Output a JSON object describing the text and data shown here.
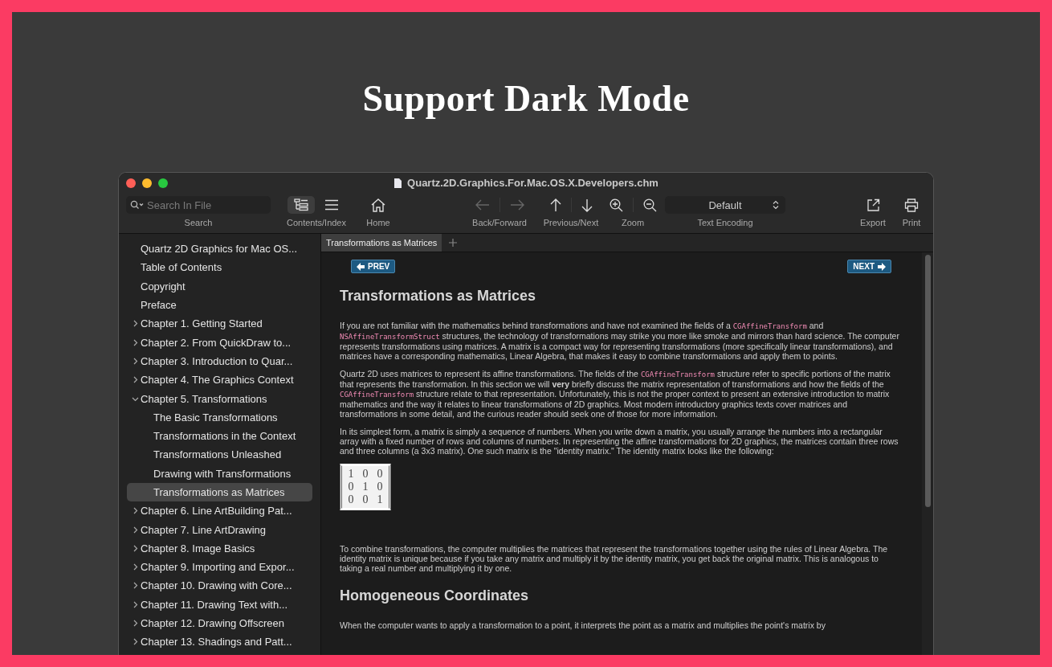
{
  "headline": "Support Dark Mode",
  "window": {
    "title": "Quartz.2D.Graphics.For.Mac.OS.X.Developers.chm"
  },
  "toolbar": [
    {
      "kind": "search",
      "label": "Search",
      "placeholder": "Search In File"
    },
    {
      "kind": "contents",
      "label": "Contents/Index",
      "selected": true
    },
    {
      "kind": "home",
      "label": "Home"
    },
    {
      "kind": "backforward",
      "label": "Back/Forward",
      "disabled": true
    },
    {
      "kind": "prevnext",
      "label": "Previous/Next"
    },
    {
      "kind": "zoom",
      "label": "Zoom"
    },
    {
      "kind": "encoding",
      "label": "Text Encoding",
      "value": "Default"
    },
    {
      "kind": "export",
      "label": "Export"
    },
    {
      "kind": "print",
      "label": "Print"
    }
  ],
  "sidebar": {
    "items": [
      {
        "label": "Quartz 2D Graphics for Mac OS...",
        "selected": false
      },
      {
        "label": "Table of Contents",
        "selected": false
      },
      {
        "label": "Copyright",
        "selected": false
      },
      {
        "label": "Preface",
        "selected": false
      },
      {
        "label": "Chapter 1.  Getting Started",
        "selected": false,
        "expanded": false
      },
      {
        "label": "Chapter 2.  From QuickDraw to...",
        "selected": false,
        "expanded": false
      },
      {
        "label": "Chapter 3.  Introduction to Quar...",
        "selected": false,
        "expanded": false
      },
      {
        "label": "Chapter 4.  The Graphics Context",
        "selected": false,
        "expanded": false
      },
      {
        "label": "Chapter 5.  Transformations",
        "selected": false,
        "expanded": true,
        "children": [
          {
            "label": "The Basic Transformations",
            "selected": false
          },
          {
            "label": "Transformations in the Context",
            "selected": false
          },
          {
            "label": "Transformations Unleashed",
            "selected": false
          },
          {
            "label": "Drawing with Transformations",
            "selected": false
          },
          {
            "label": "Transformations as Matrices",
            "selected": true
          }
        ]
      },
      {
        "label": "Chapter 6.  Line ArtBuilding Pat...",
        "selected": false,
        "expanded": false
      },
      {
        "label": "Chapter 7.  Line ArtDrawing",
        "selected": false,
        "expanded": false
      },
      {
        "label": "Chapter 8.  Image Basics",
        "selected": false,
        "expanded": false
      },
      {
        "label": "Chapter 9.  Importing and Expor...",
        "selected": false,
        "expanded": false
      },
      {
        "label": "Chapter 10.  Drawing with Core...",
        "selected": false,
        "expanded": false
      },
      {
        "label": "Chapter 11.  Drawing Text with...",
        "selected": false,
        "expanded": false
      },
      {
        "label": "Chapter 12.  Drawing Offscreen",
        "selected": false,
        "expanded": false
      },
      {
        "label": "Chapter 13.  Shadings and Patt...",
        "selected": false,
        "expanded": false
      }
    ]
  },
  "tabs": [
    {
      "label": "Transformations as Matrices",
      "selected": true
    }
  ],
  "document": {
    "prev": "PREV",
    "next": "NEXT",
    "blocks": [
      {
        "kind": "heading",
        "text": "Transformations as Matrices"
      },
      {
        "kind": "paragraph",
        "segments": [
          {
            "kind": "text",
            "text": "If you are not familiar with the mathematics behind transformations and have not examined the fields of a "
          },
          {
            "kind": "code",
            "text": "CGAffineTransform"
          },
          {
            "kind": "text",
            "text": " and "
          },
          {
            "kind": "code",
            "text": "NSAffineTransformStruct"
          },
          {
            "kind": "text",
            "text": " structures, the technology of transformations may strike you more like smoke and mirrors than hard science. The computer represents transformations using matrices. A matrix is a compact way for representing transformations (more specifically linear transformations), and matrices have a corresponding mathematics, Linear Algebra, that makes it easy to combine transformations and apply them to points."
          }
        ]
      },
      {
        "kind": "paragraph",
        "segments": [
          {
            "kind": "text",
            "text": "Quartz 2D uses matrices to represent its affine transformations. The fields of the "
          },
          {
            "kind": "code",
            "text": "CGAffineTransform"
          },
          {
            "kind": "text",
            "text": " structure refer to specific portions of the matrix that represents the transformation. In this section we will "
          },
          {
            "kind": "bold",
            "text": "very"
          },
          {
            "kind": "text",
            "text": " briefly discuss the matrix representation of transformations and how the fields of the "
          },
          {
            "kind": "code",
            "text": "CGAffineTransform"
          },
          {
            "kind": "text",
            "text": " structure relate to that representation. Unfortunately, this is not the proper context to present an extensive introduction to matrix mathematics and the way it relates to linear transformations of 2D graphics. Most modern introductory graphics texts cover matrices and transformations in some detail, and the curious reader should seek one of those for more information."
          }
        ]
      },
      {
        "kind": "paragraph",
        "segments": [
          {
            "kind": "text",
            "text": "In its simplest form, a matrix is simply a sequence of numbers. When you write down a matrix, you usually arrange the numbers into a rectangular array with a fixed number of rows and columns of numbers. In representing the affine transformations for 2D graphics, the matrices contain three rows and three columns (a 3x3 matrix). One such matrix is the \"identity matrix.\" The identity matrix looks like the following:"
          }
        ]
      },
      {
        "kind": "matrix",
        "rows": [
          [
            "1",
            "0",
            "0"
          ],
          [
            "0",
            "1",
            "0"
          ],
          [
            "0",
            "0",
            "1"
          ]
        ]
      },
      {
        "kind": "paragraph",
        "segments": [
          {
            "kind": "text",
            "text": "To combine transformations, the computer multiplies the matrices that represent the transformations together using the rules of Linear Algebra. The identity matrix is unique because if you take any matrix and multiply it by the identity matrix, you get back the original matrix. This is analogous to taking a real number and multiplying it by one."
          }
        ]
      },
      {
        "kind": "heading",
        "text": "Homogeneous Coordinates"
      },
      {
        "kind": "paragraph",
        "segments": [
          {
            "kind": "text",
            "text": "When the computer wants to apply a transformation to a point, it interprets the point as a matrix and multiplies the point's matrix by"
          }
        ]
      }
    ]
  }
}
